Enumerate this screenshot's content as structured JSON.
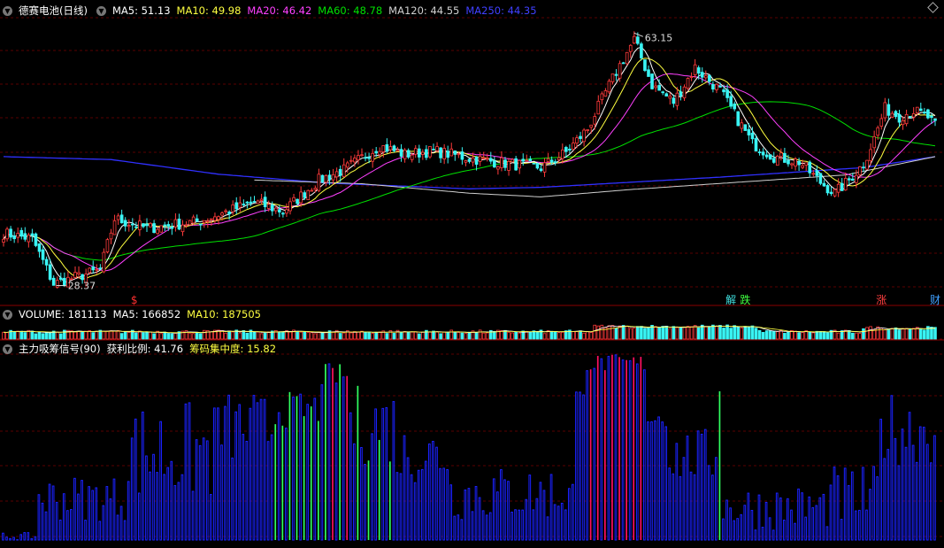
{
  "colors": {
    "up": "#ff3b3b",
    "down": "#39f4f4",
    "ma5": "#ffffff",
    "ma10": "#ffff40",
    "ma20": "#ff40ff",
    "ma60": "#00e000",
    "ma120": "#d0d0d0",
    "ma250": "#3030ff",
    "grid": "#5a0000",
    "bar_blue": "#1a22ff",
    "bar_green": "#30ff60",
    "bar_red": "#ff1060"
  },
  "header": {
    "icon": "chevron-down-icon",
    "title": "德赛电池(日线)",
    "ma5": "MA5: 51.13",
    "ma10": "MA10: 49.98",
    "ma20": "MA20: 46.42",
    "ma60": "MA60: 48.78",
    "ma120": "MA120: 44.55",
    "ma250": "MA250: 44.35"
  },
  "volume_header": {
    "volume": "VOLUME: 181113",
    "ma5": "MA5: 166852",
    "ma10": "MA10: 187505"
  },
  "indicator_header": {
    "name": "主力吸筹信号(90)",
    "profit": "获利比例: 41.76",
    "concentration": "筹码集中度: 15.82"
  },
  "annotations": {
    "high": "63.15",
    "low": "28.37",
    "markers": [
      {
        "text": "$",
        "color": "#ff3030",
        "index": 37
      },
      {
        "text": "解",
        "color": "#40e0e0",
        "index": 203
      },
      {
        "text": "跌",
        "color": "#40ff40",
        "index": 207
      },
      {
        "text": "涨",
        "color": "#ff4040",
        "index": 245
      },
      {
        "text": "财",
        "color": "#40a0ff",
        "index": 260
      }
    ]
  },
  "chart_data": {
    "type": "candlestick",
    "points": 261,
    "price_range": [
      26.5,
      65.0
    ],
    "anchors_close": [
      [
        0,
        35.5
      ],
      [
        8,
        34.8
      ],
      [
        14,
        28.6
      ],
      [
        20,
        29.5
      ],
      [
        27,
        30.5
      ],
      [
        31,
        37.5
      ],
      [
        40,
        36.2
      ],
      [
        55,
        37.2
      ],
      [
        70,
        39.8
      ],
      [
        78,
        38.5
      ],
      [
        88,
        42.8
      ],
      [
        95,
        44.2
      ],
      [
        105,
        47.5
      ],
      [
        112,
        46.3
      ],
      [
        120,
        46.8
      ],
      [
        130,
        45.8
      ],
      [
        140,
        45.1
      ],
      [
        150,
        44.5
      ],
      [
        157,
        46.6
      ],
      [
        163,
        49.8
      ],
      [
        168,
        54.8
      ],
      [
        172,
        58.5
      ],
      [
        176,
        62.0
      ],
      [
        181,
        55.8
      ],
      [
        187,
        53.5
      ],
      [
        193,
        58.2
      ],
      [
        200,
        55.0
      ],
      [
        205,
        51.0
      ],
      [
        209,
        47.8
      ],
      [
        215,
        46.0
      ],
      [
        222,
        45.3
      ],
      [
        228,
        42.5
      ],
      [
        232,
        41.0
      ],
      [
        236,
        42.8
      ],
      [
        240,
        45.0
      ],
      [
        243,
        48.5
      ],
      [
        246,
        52.6
      ],
      [
        250,
        51.5
      ],
      [
        254,
        52.3
      ],
      [
        258,
        51.4
      ],
      [
        260,
        50.2
      ]
    ],
    "ma250_anchors": [
      [
        0,
        46.0
      ],
      [
        30,
        45.6
      ],
      [
        60,
        43.6
      ],
      [
        90,
        42.4
      ],
      [
        130,
        41.6
      ],
      [
        150,
        41.8
      ],
      [
        200,
        43.2
      ],
      [
        240,
        44.5
      ],
      [
        260,
        46.0
      ]
    ],
    "ma120_anchors": [
      [
        70,
        42.8
      ],
      [
        100,
        42.3
      ],
      [
        130,
        41.0
      ],
      [
        150,
        40.5
      ],
      [
        175,
        41.5
      ],
      [
        205,
        42.5
      ],
      [
        235,
        43.5
      ],
      [
        260,
        46.0
      ]
    ],
    "indicator_range": [
      0,
      100
    ]
  }
}
